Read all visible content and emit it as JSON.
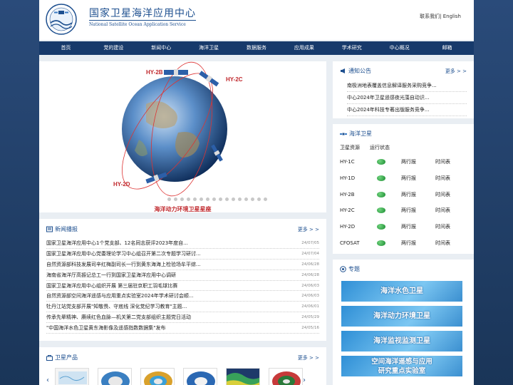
{
  "header": {
    "title": "国家卫星海洋应用中心",
    "subtitle": "National Satellite Ocean Application Service",
    "contact": "联系我们",
    "sep": "|",
    "english": "English"
  },
  "nav": [
    "首页",
    "党的建设",
    "新闻中心",
    "海洋卫星",
    "数据服务",
    "应用成果",
    "学术研究",
    "中心概况",
    "邮箱"
  ],
  "hero": {
    "labels": {
      "hy2b": "HY-2B",
      "hy2c": "HY-2C",
      "hy2d": "HY-2D"
    },
    "caption": "海洋动力环境卫星星座",
    "slide_count": 16
  },
  "news": {
    "title": "新闻播报",
    "more": "更多 > >",
    "items": [
      {
        "title": "国家卫星海洋应用中心1个党支部、12名同志获评2023年度自...",
        "date": "24/07/05"
      },
      {
        "title": "国家卫星海洋应用中心党委理论学习中心组召开第二次专题学习研讨...",
        "date": "24/07/04"
      },
      {
        "title": "自然资源部科技发展司辛红梅副司长一行到黄东海海上检验场牟平综...",
        "date": "24/06/28"
      },
      {
        "title": "海南省海洋厅高振记总工一行到国家卫星海洋应用中心调研",
        "date": "24/06/28"
      },
      {
        "title": "国家卫星海洋应用中心组织开展 第三届驻京职工羽毛球比赛",
        "date": "24/06/03"
      },
      {
        "title": "自然资源部空间海洋遥感与应用重点实验室2024年学术研讨会顺...",
        "date": "24/06/03"
      },
      {
        "title": "牡丹江站党支部开展\"知敬畏、守底线 深化党纪学习教育\"主题...",
        "date": "24/06/01"
      },
      {
        "title": "传承先辈精神、赓续红色血脉—机关第二党支部组织主题党日活动",
        "date": "24/05/29"
      },
      {
        "title": "\"中国海洋水色卫星黄东海影像及遥感指数数据集\"发布",
        "date": "24/05/16"
      }
    ]
  },
  "products": {
    "title": "卫星产品",
    "more": "更多 > >",
    "prev": "‹",
    "next": "›"
  },
  "notice": {
    "title": "通知公告",
    "more": "更多 > >",
    "items": [
      "南极洲地表覆盖信息解译服务采购竞争...",
      "中心2024年卫星遥感夜光藻自动识...",
      "中心2024年科技专著出版服务竞争..."
    ]
  },
  "satellites": {
    "title": "海洋卫星",
    "col_resource": "卫星资源",
    "col_status": "运行状态",
    "items": [
      {
        "name": "HY-1C",
        "link1": "两行报",
        "link2": "时间表"
      },
      {
        "name": "HY-1D",
        "link1": "两行报",
        "link2": "时间表"
      },
      {
        "name": "HY-2B",
        "link1": "两行报",
        "link2": "时间表"
      },
      {
        "name": "HY-2C",
        "link1": "两行报",
        "link2": "时间表"
      },
      {
        "name": "HY-2D",
        "link1": "两行报",
        "link2": "时间表"
      },
      {
        "name": "CFOSAT",
        "link1": "两行报",
        "link2": "时间表"
      }
    ]
  },
  "topics": {
    "title": "专题",
    "banners": [
      "海洋水色卫星",
      "海洋动力环境卫星",
      "海洋监视监测卫星"
    ],
    "banner4_line1": "空间海洋遥感与应用",
    "banner4_line2": "研究重点实验室"
  },
  "colors": {
    "brand": "#1d4f8f",
    "nav": "#173a6b",
    "accent_red": "#c0282d",
    "status_green": "#1a8a30"
  }
}
